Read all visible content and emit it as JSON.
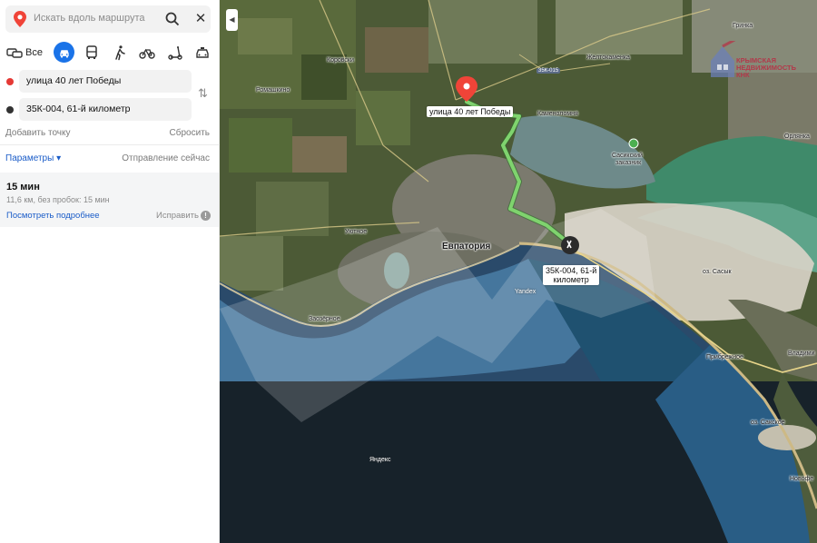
{
  "search": {
    "placeholder": "Искать вдоль маршрута"
  },
  "modes": {
    "all_label": "Все"
  },
  "waypoints": [
    {
      "text": "улица 40 лет Победы"
    },
    {
      "text": "35К-004, 61-й километр"
    }
  ],
  "actions": {
    "add_point": "Добавить точку",
    "reset": "Сбросить"
  },
  "params": {
    "label": "Параметры ▾",
    "departure": "Отправление сейчас"
  },
  "route": {
    "time": "15 мин",
    "info": "11,6 км, без пробок: 15 мин",
    "details": "Посмотреть подробнее",
    "fix": "Исправить"
  },
  "map": {
    "places": {
      "korovsky": "Коровски",
      "romashkino": "Ромашкино",
      "zheltokamenka": "Желтокаменка",
      "kamenomost": "Каменоломня",
      "sasikski": "Сасикский",
      "zakaznik": "заказник",
      "orlyanka": "Орлянка",
      "ukrainka": "Уютное",
      "zaozernoe": "Заозёрное",
      "evpatoria": "Евпатория",
      "zaozernoe2": "Заозёрное",
      "sasyk": "оз. Сасык",
      "pribrezhnoe": "Прибрежное",
      "vladimir": "Владими",
      "saksky": "оз. Сакское",
      "novofedor": "Новофе",
      "yandex1": "Yandex",
      "yandex2": "Яндекс",
      "grinka": "Гринка"
    },
    "road_badge": "35К-015",
    "route_start_label": "улица 40 лет Победы",
    "route_end_label": "35К-004, 61-й\nкилометр",
    "watermark": "КРЫМСКАЯ\nНЕДВИЖИМОСТЬ\nКНК"
  },
  "colors": {
    "accent": "#1a73e8",
    "route": "#7fd36e",
    "marker": "#e53935"
  }
}
